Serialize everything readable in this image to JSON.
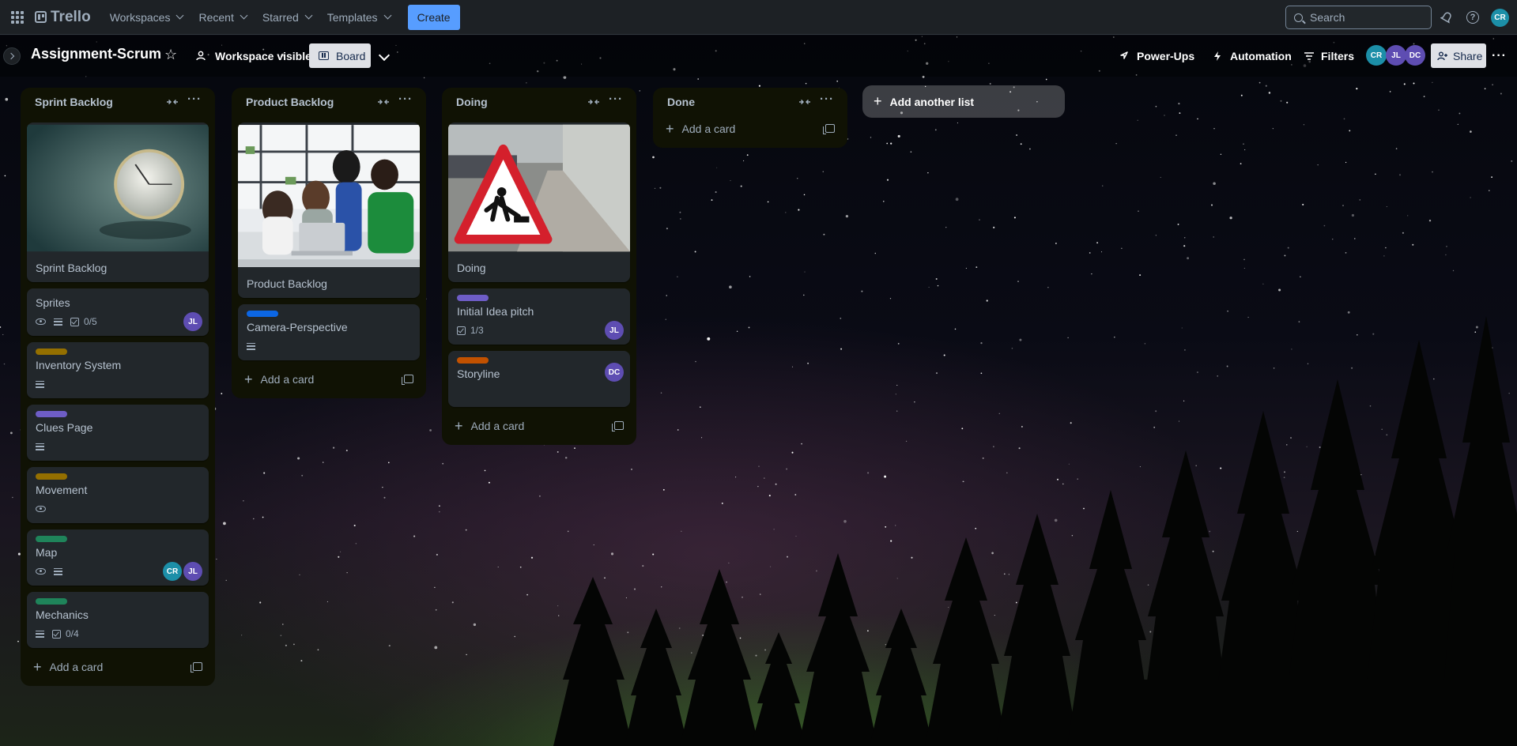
{
  "topbar": {
    "logo": "Trello",
    "nav": [
      {
        "label": "Workspaces"
      },
      {
        "label": "Recent"
      },
      {
        "label": "Starred"
      },
      {
        "label": "Templates"
      }
    ],
    "create_label": "Create",
    "search_placeholder": "Search",
    "user_initials": "CR"
  },
  "board": {
    "title": "Assignment-Scrum",
    "visibility_label": "Workspace visible",
    "view_label": "Board",
    "powerups_label": "Power-Ups",
    "automation_label": "Automation",
    "filters_label": "Filters",
    "members": [
      "CR",
      "JL",
      "DC"
    ],
    "share_label": "Share"
  },
  "lists": [
    {
      "title": "Sprint Backlog",
      "cards": [
        {
          "title": "Sprint Backlog",
          "cover": "clock"
        },
        {
          "title": "Sprites",
          "badges": {
            "watch": true,
            "description": true,
            "checklist": "0/5"
          },
          "members": [
            "JL"
          ]
        },
        {
          "title": "Inventory System",
          "label_color": "#946f00",
          "badges": {
            "description": true
          }
        },
        {
          "title": "Clues Page",
          "label_color": "#6e5dc6",
          "badges": {
            "description": true
          }
        },
        {
          "title": "Movement",
          "label_color": "#946f00",
          "badges": {
            "watch": true
          }
        },
        {
          "title": "Map",
          "label_color": "#1f845a",
          "badges": {
            "watch": true,
            "description": true
          },
          "members": [
            "CR",
            "JL"
          ]
        },
        {
          "title": "Mechanics",
          "label_color": "#1f845a",
          "badges": {
            "description": true,
            "checklist": "0/4"
          }
        }
      ],
      "add_card_label": "Add a card"
    },
    {
      "title": "Product Backlog",
      "cards": [
        {
          "title": "Product Backlog",
          "cover": "team"
        },
        {
          "title": "Camera-Perspective",
          "label_color": "#0c66e4",
          "badges": {
            "description": true
          }
        }
      ],
      "add_card_label": "Add a card"
    },
    {
      "title": "Doing",
      "cards": [
        {
          "title": "Doing",
          "cover": "roadwork"
        },
        {
          "title": "Initial Idea pitch",
          "label_color": "#6e5dc6",
          "badges": {
            "checklist": "1/3"
          },
          "members": [
            "JL"
          ]
        },
        {
          "title": "Storyline",
          "label_color": "#c25100",
          "members": [
            "DC"
          ]
        }
      ],
      "add_card_label": "Add a card"
    },
    {
      "title": "Done",
      "cards": [],
      "add_card_label": "Add a card"
    }
  ],
  "add_list_label": "Add another list",
  "colors": {
    "accent": "#579dff",
    "cr_avatar": "#1c8fa8",
    "jl_avatar": "#5e4db2",
    "dc_avatar": "#5e4db2"
  }
}
